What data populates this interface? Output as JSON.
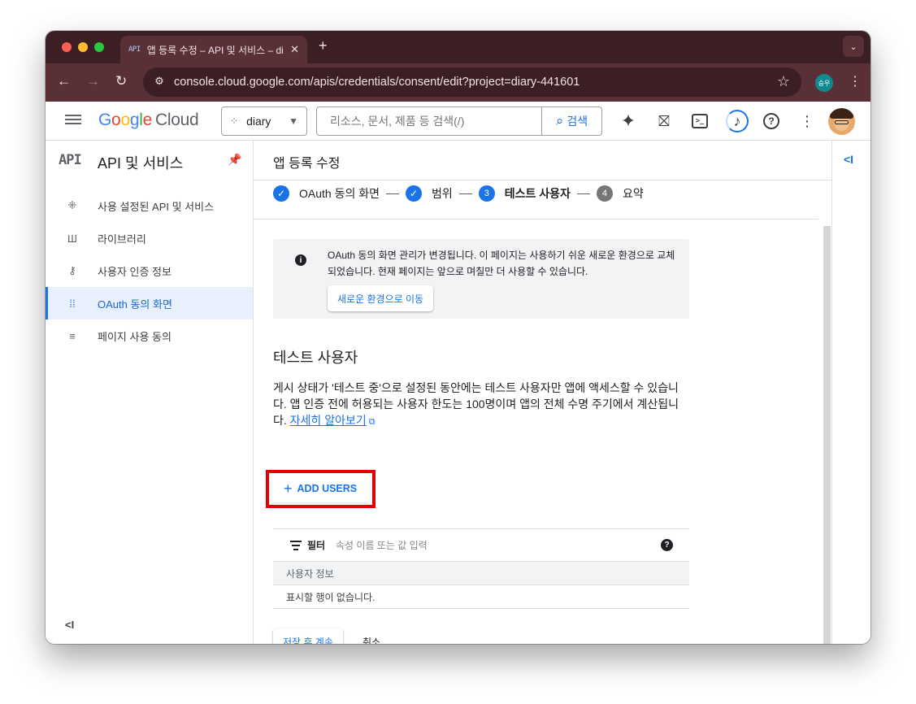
{
  "browser": {
    "tab_favicon": "API",
    "tab_title": "앱 등록 수정 – API 및 서비스 – di",
    "tab_close": "✕",
    "new_tab": "+",
    "url": "console.cloud.google.com/apis/credentials/consent/edit?project=diary-441601",
    "profile_badge": "승우"
  },
  "header": {
    "logo_letters": [
      "G",
      "o",
      "o",
      "g",
      "l",
      "e"
    ],
    "logo_product": "Cloud",
    "project_name": "diary",
    "search_placeholder": "리소스, 문서, 제품 등 검색(/)",
    "search_button": "검색"
  },
  "sidebar": {
    "logo": "API",
    "title": "API 및 서비스",
    "items": [
      {
        "label": "사용 설정된 API 및 서비스",
        "icon": "diamond-dots-icon",
        "active": false
      },
      {
        "label": "라이브러리",
        "icon": "library-icon",
        "active": false
      },
      {
        "label": "사용자 인증 정보",
        "icon": "key-icon",
        "active": false
      },
      {
        "label": "OAuth 동의 화면",
        "icon": "consent-grid-icon",
        "active": true
      },
      {
        "label": "페이지 사용 동의",
        "icon": "list-settings-icon",
        "active": false
      }
    ],
    "collapse": "<I"
  },
  "main": {
    "title": "앱 등록 수정",
    "steps": [
      {
        "label": "OAuth 동의 화면",
        "state": "done"
      },
      {
        "label": "범위",
        "state": "done"
      },
      {
        "label": "테스트 사용자",
        "state": "current",
        "number": "3"
      },
      {
        "label": "요약",
        "state": "pending",
        "number": "4"
      }
    ],
    "notice": {
      "text": "OAuth 동의 화면 관리가 변경됩니다. 이 페이지는 사용하기 쉬운 새로운 환경으로 교체되었습니다. 현재 페이지는 앞으로 며칠만 더 사용할 수 있습니다.",
      "button": "새로운 환경으로 이동"
    },
    "section_title": "테스트 사용자",
    "section_desc": "게시 상태가 '테스트 중'으로 설정된 동안에는 테스트 사용자만 앱에 액세스할 수 있습니다. 앱 인증 전에 허용되는 사용자 한도는 100명이며 앱의 전체 수명 주기에서 계산됩니다.",
    "learn_more": "자세히 알아보기",
    "add_users": "ADD USERS",
    "filter_label": "필터",
    "filter_placeholder": "속성 이름 또는 값 입력",
    "table_header": "사용자 정보",
    "table_empty": "표시할 행이 없습니다.",
    "save_button": "저장 후 계속",
    "cancel_button": "취소"
  },
  "colors": {
    "accent": "#1a73e8",
    "highlight_frame": "#e30000",
    "chrome_dark": "#3b1f24",
    "chrome_toolbar": "#5a3037"
  }
}
